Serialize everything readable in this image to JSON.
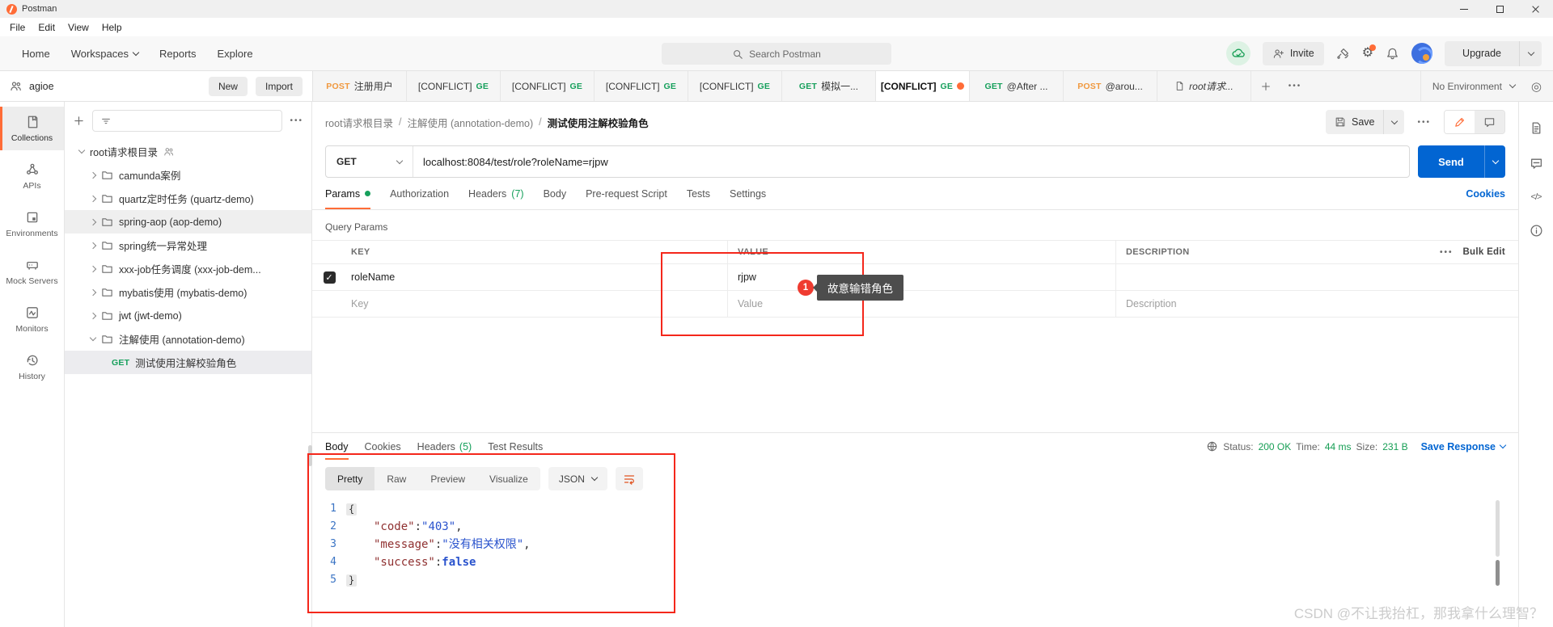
{
  "window": {
    "title": "Postman"
  },
  "menu": {
    "items": [
      "File",
      "Edit",
      "View",
      "Help"
    ]
  },
  "topnav": {
    "home": "Home",
    "workspaces": "Workspaces",
    "reports": "Reports",
    "explore": "Explore",
    "search_placeholder": "Search Postman",
    "invite": "Invite",
    "upgrade": "Upgrade"
  },
  "workspace": {
    "name": "agioe",
    "new_btn": "New",
    "import_btn": "Import"
  },
  "tabstrip": {
    "tabs": [
      {
        "method": "POST",
        "title": "注册用户"
      },
      {
        "title": "[CONFLICT]",
        "method": "GE"
      },
      {
        "title": "[CONFLICT]",
        "method": "GE"
      },
      {
        "title": "[CONFLICT]",
        "method": "GE"
      },
      {
        "title": "[CONFLICT]",
        "method": "GE"
      },
      {
        "method": "GET",
        "title": "模拟一..."
      },
      {
        "title": "[CONFLICT]",
        "method": "GE"
      },
      {
        "method": "GET",
        "title": "@After ..."
      },
      {
        "method": "POST",
        "title": "@arou..."
      },
      {
        "title": "root请求..."
      }
    ],
    "environment": "No Environment"
  },
  "rail": {
    "items": [
      "Collections",
      "APIs",
      "Environments",
      "Mock Servers",
      "Monitors",
      "History"
    ]
  },
  "sidebar": {
    "root_label": "root请求根目录",
    "folders": [
      {
        "label": "camunda案例"
      },
      {
        "label": "quartz定时任务 (quartz-demo)"
      },
      {
        "label": "spring-aop (aop-demo)"
      },
      {
        "label": "spring统一异常处理"
      },
      {
        "label": "xxx-job任务调度 (xxx-job-dem..."
      },
      {
        "label": "mybatis使用 (mybatis-demo)"
      },
      {
        "label": "jwt (jwt-demo)"
      },
      {
        "label": "注解使用 (annotation-demo)"
      }
    ],
    "request": {
      "method": "GET",
      "label": "测试使用注解校验角色"
    }
  },
  "breadcrumb": {
    "root": "root请求根目录",
    "folder": "注解使用 (annotation-demo)",
    "current": "测试使用注解校验角色",
    "separator": "/"
  },
  "header_actions": {
    "save": "Save"
  },
  "request": {
    "method": "GET",
    "url": "localhost:8084/test/role?roleName=rjpw",
    "send": "Send"
  },
  "request_tabs": {
    "params": "Params",
    "authorization": "Authorization",
    "headers": "Headers",
    "headers_count": "(7)",
    "body": "Body",
    "pre_request": "Pre-request Script",
    "tests": "Tests",
    "settings": "Settings",
    "cookies": "Cookies"
  },
  "query_params": {
    "title": "Query Params",
    "col_key": "KEY",
    "col_value": "VALUE",
    "col_description": "DESCRIPTION",
    "bulk_edit": "Bulk Edit",
    "row": {
      "key": "roleName",
      "value": "rjpw"
    },
    "placeholder": {
      "key": "Key",
      "value": "Value",
      "description": "Description"
    }
  },
  "annotation": {
    "badge": "1",
    "tooltip": "故意输错角色"
  },
  "response": {
    "tab_body": "Body",
    "tab_cookies": "Cookies",
    "tab_headers": "Headers",
    "headers_count": "(5)",
    "tab_tests": "Test Results",
    "status_label": "Status:",
    "status_value": "200 OK",
    "time_label": "Time:",
    "time_value": "44 ms",
    "size_label": "Size:",
    "size_value": "231 B",
    "save_response": "Save Response",
    "views": {
      "pretty": "Pretty",
      "raw": "Raw",
      "preview": "Preview",
      "visualize": "Visualize"
    },
    "format": "JSON"
  },
  "response_code": {
    "n1": "1",
    "n2": "2",
    "n3": "3",
    "n4": "4",
    "n5": "5",
    "open_brace": "{",
    "close_brace": "}",
    "k_code": "\"code\"",
    "v_code": "\"403\"",
    "k_message": "\"message\"",
    "v_message": "\"没有相关权限\"",
    "k_success": "\"success\"",
    "v_success": "false",
    "colon": ": ",
    "comma": ","
  },
  "icons": {
    "gear": "⚙",
    "env_quick_look": "◎",
    "more": "•••",
    "code": "</>",
    "check": "✓"
  },
  "watermark": "CSDN @不让我抬杠，那我拿什么理智？",
  "colors": {
    "accent_orange": "#ff6c37",
    "method_get_green": "#17a05c",
    "method_post_orange": "#f0983e",
    "link_blue": "#0265d2",
    "status_green": "#169e54",
    "annotation_red": "#f4271b"
  }
}
